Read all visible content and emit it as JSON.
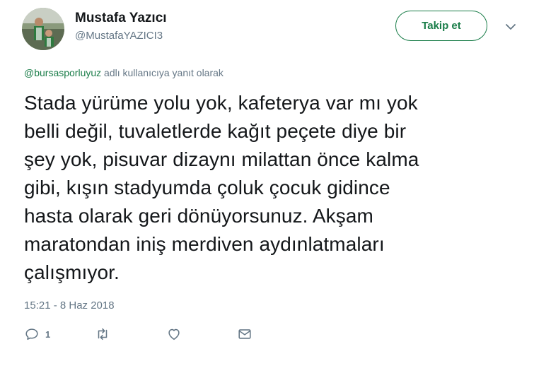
{
  "user": {
    "name": "Mustafa Yazıcı",
    "handle": "@MustafaYAZICI3",
    "avatar_icon": "profile-photo"
  },
  "follow_button": {
    "label": "Takip et"
  },
  "reply_context": {
    "mention": "@bursasporluyuz",
    "suffix": " adlı kullanıcıya yanıt olarak"
  },
  "tweet": {
    "lines": [
      "Stada yürüme yolu yok, kafeterya var mı yok",
      "belli değil, tuvaletlerde kağıt peçete diye bir",
      "şey yok, pisuvar dizaynı milattan önce kalma",
      "gibi, kışın stadyumda çoluk çocuk gidince",
      "hasta olarak geri dönüyorsunuz. Akşam",
      "maratondan iniş merdiven aydınlatmaları",
      "çalışmıyor."
    ]
  },
  "timestamp": "15:21 - 8 Haz 2018",
  "actions": {
    "reply_count": "1",
    "icons": [
      "reply-icon",
      "retweet-icon",
      "like-icon",
      "message-icon"
    ]
  },
  "colors": {
    "accent": "#1a7d49",
    "text": "#14171a",
    "muted": "#657786"
  }
}
